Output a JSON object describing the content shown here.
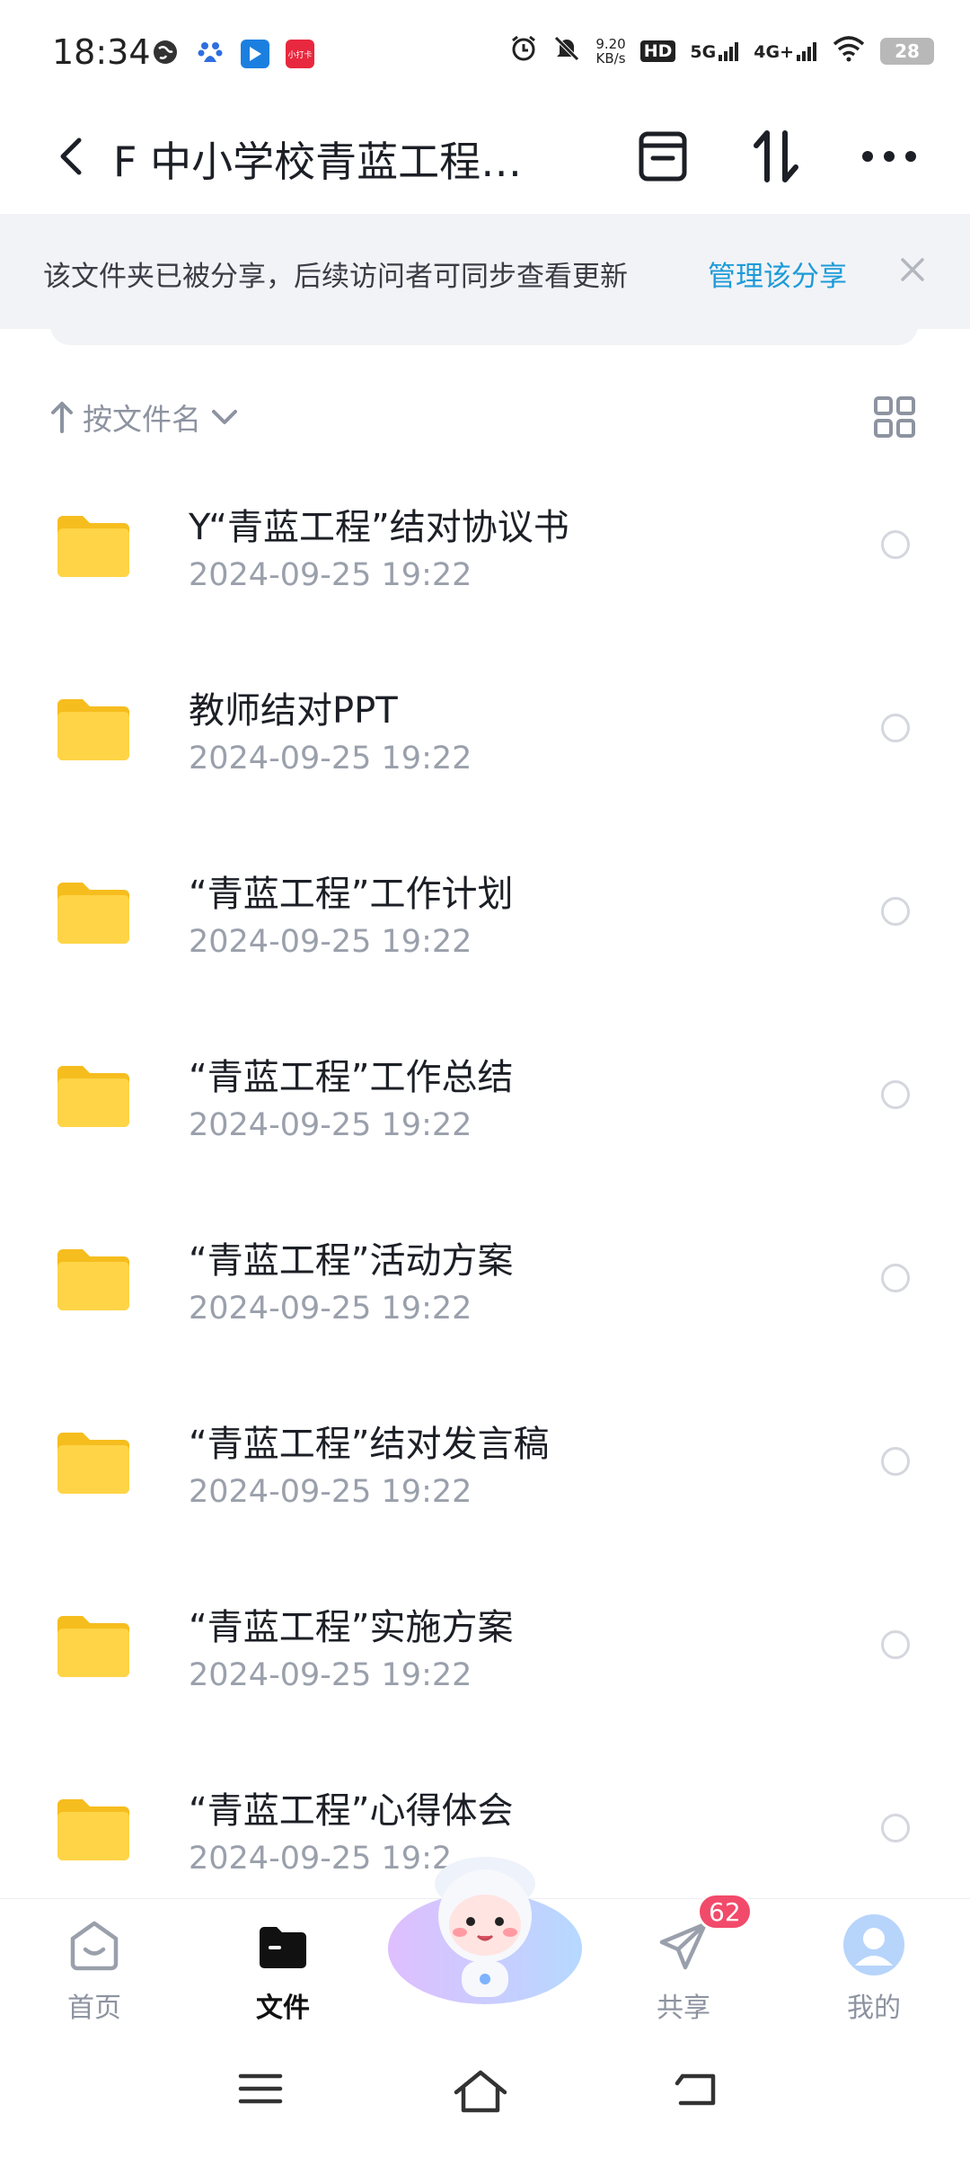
{
  "status_bar": {
    "time": "18:34",
    "net_speed_value": "9.20",
    "net_speed_unit": "KB/s",
    "hd_label": "HD",
    "sim1_label": "5G",
    "sim2_label": "4G+",
    "battery": "28",
    "app_icon_text": "小打卡",
    "icons": [
      "globe-icon",
      "baidu-paw-icon",
      "play-store-icon",
      "red-app-icon",
      "alarm-icon",
      "mute-icon",
      "wifi-icon",
      "battery-icon"
    ]
  },
  "header": {
    "title": "F 中小学校青蓝工程…",
    "icons": [
      "back-arrow-icon",
      "archive-icon",
      "sort-arrows-icon",
      "more-dots-icon"
    ]
  },
  "share_banner": {
    "text": "该文件夹已被分享，后续访问者可同步查看更新",
    "link": "管理该分享",
    "close_icon": "close-icon"
  },
  "sort": {
    "label": "按文件名",
    "icons": [
      "sort-up-arrow-icon",
      "chevron-down-icon",
      "grid-view-icon"
    ]
  },
  "files": [
    {
      "name": "Y“青蓝工程”结对协议书",
      "date": "2024-09-25  19:22"
    },
    {
      "name": "教师结对PPT",
      "date": "2024-09-25  19:22"
    },
    {
      "name": "“青蓝工程”工作计划",
      "date": "2024-09-25  19:22"
    },
    {
      "name": "“青蓝工程”工作总结",
      "date": "2024-09-25  19:22"
    },
    {
      "name": "“青蓝工程”活动方案",
      "date": "2024-09-25  19:22"
    },
    {
      "name": "“青蓝工程”结对发言稿",
      "date": "2024-09-25  19:22"
    },
    {
      "name": "“青蓝工程”实施方案",
      "date": "2024-09-25  19:22"
    },
    {
      "name": "“青蓝工程”心得体会",
      "date": "2024-09-25  19:2"
    }
  ],
  "bottom_nav": {
    "items": [
      {
        "label": "首页",
        "icon": "home-face-icon",
        "active": false
      },
      {
        "label": "文件",
        "icon": "folder-icon",
        "active": true
      },
      {
        "label": "共享",
        "icon": "send-plane-icon",
        "active": false
      },
      {
        "label": "我的",
        "icon": "profile-avatar-icon",
        "active": false
      }
    ],
    "share_badge": "62",
    "mascot_icon": "assistant-mascot-icon"
  },
  "system_nav": {
    "icons": [
      "menu-lines-icon",
      "home-outline-icon",
      "back-return-icon"
    ]
  },
  "colors": {
    "accent_link": "#1d9bd8",
    "folder_yellow": "#ffcf3a",
    "badge_red": "#f24a6a",
    "banner_bg": "#f2f3f6"
  }
}
